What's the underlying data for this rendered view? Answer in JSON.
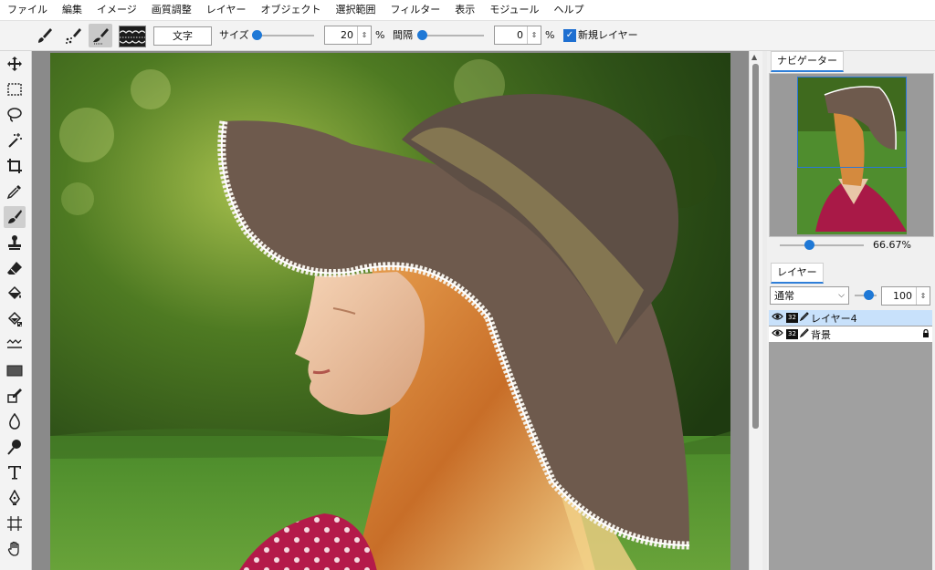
{
  "menu": [
    "ファイル",
    "編集",
    "イメージ",
    "画質調整",
    "レイヤー",
    "オブジェクト",
    "選択範囲",
    "フィルター",
    "表示",
    "モジュール",
    "ヘルプ"
  ],
  "toolbar": {
    "text_button": "文字",
    "size_label": "サイズ",
    "size_value": "20",
    "size_unit": "%",
    "size_slider_level": 0.05,
    "spacing_label": "間隔",
    "spacing_value": "0",
    "spacing_unit": "%",
    "spacing_slider_level": 0.0,
    "new_layer_label": "新規レイヤー",
    "new_layer_checked": true,
    "active_brush_tool": "lace-brush-icon"
  },
  "tools": [
    "move-icon",
    "rect-select-icon",
    "lasso-icon",
    "magic-wand-icon",
    "crop-icon",
    "eyedropper-icon",
    "brush-icon",
    "stamp-icon",
    "eraser-icon",
    "fill-icon",
    "fill-pattern-icon",
    "wave-icon",
    "rectangle-shape-icon",
    "edit-shape-icon",
    "drop-icon",
    "smudge-icon",
    "text-icon",
    "pen-icon",
    "grid-transform-icon",
    "hand-icon"
  ],
  "active_tool": "brush-icon",
  "navigator": {
    "tab_label": "ナビゲーター",
    "zoom_label": "66.67%",
    "zoom_level": 0.35
  },
  "layers": {
    "tab_label": "レイヤー",
    "blend_mode": "通常",
    "opacity": "100",
    "items": [
      {
        "name": "レイヤー4",
        "depth": "32",
        "selected": true,
        "locked": false
      },
      {
        "name": "背景",
        "depth": "32",
        "selected": false,
        "locked": true
      }
    ]
  },
  "colors": {
    "accent": "#1e78d6",
    "selected_layer": "#c8e1fb",
    "hat_brown": "#6e5a4d",
    "hat_band": "#847651",
    "dress_red": "#b41a4a"
  }
}
